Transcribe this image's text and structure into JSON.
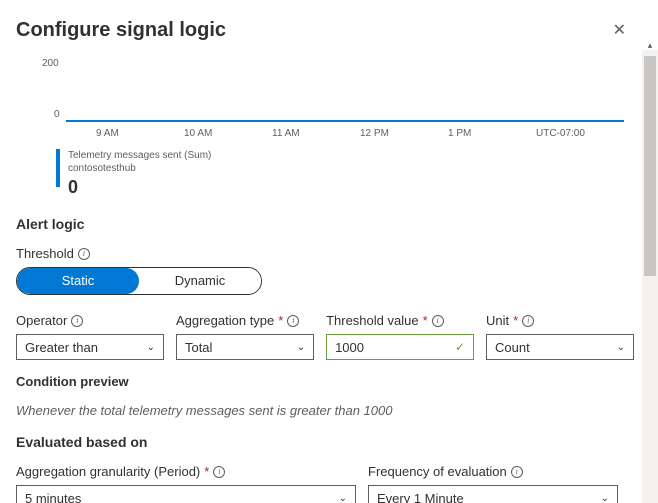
{
  "header": {
    "title": "Configure signal logic"
  },
  "chart_data": {
    "type": "line",
    "categories": [
      "9 AM",
      "10 AM",
      "11 AM",
      "12 PM",
      "1 PM"
    ],
    "values": [
      0,
      0,
      0,
      0,
      0
    ],
    "ylim": [
      0,
      200
    ],
    "y_ticks": [
      "200",
      "0"
    ],
    "timezone": "UTC-07:00",
    "legend": {
      "metric": "Telemetry messages sent (Sum)",
      "resource": "contosotesthub",
      "value": "0"
    }
  },
  "alert": {
    "section": "Alert logic",
    "threshold_label": "Threshold",
    "toggle": {
      "static": "Static",
      "dynamic": "Dynamic"
    },
    "operator": {
      "label": "Operator",
      "value": "Greater than"
    },
    "agg_type": {
      "label": "Aggregation type",
      "value": "Total"
    },
    "threshold_value": {
      "label": "Threshold value",
      "value": "1000"
    },
    "unit": {
      "label": "Unit",
      "value": "Count"
    }
  },
  "preview": {
    "label": "Condition preview",
    "text": "Whenever the total telemetry messages sent is greater than 1000"
  },
  "eval": {
    "section": "Evaluated based on",
    "granularity": {
      "label": "Aggregation granularity (Period)",
      "value": "5 minutes"
    },
    "frequency": {
      "label": "Frequency of evaluation",
      "value": "Every 1 Minute"
    }
  }
}
